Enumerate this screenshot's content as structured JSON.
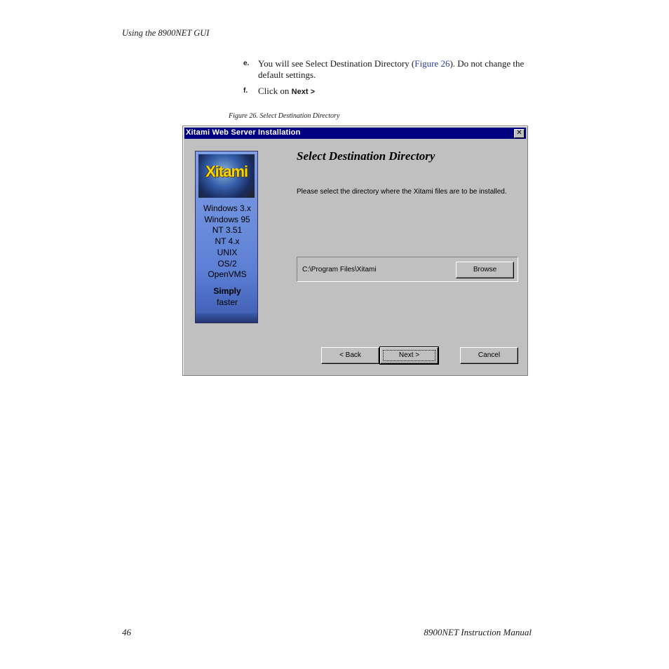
{
  "header": {
    "section": "Using the 8900NET GUI"
  },
  "steps": [
    {
      "label": "e.",
      "pre": "You will see Select Destination Directory (",
      "link": "Figure 26",
      "post": "). Do not change the default settings."
    },
    {
      "label": "f.",
      "pre": "Click on ",
      "action": "Next >"
    }
  ],
  "figure": {
    "caption": "Figure 26.  Select Destination Directory"
  },
  "dialog": {
    "title": "Xitami Web Server Installation",
    "close_glyph": "✕",
    "banner": {
      "logo": "Xitami",
      "platforms": [
        "Windows 3.x",
        "Windows 95",
        "NT 3.51",
        "NT 4.x",
        "UNIX",
        "OS/2",
        "OpenVMS"
      ],
      "tagline_1": "Simply",
      "tagline_2": "faster"
    },
    "heading": "Select Destination Directory",
    "instructions": "Please select the directory where the Xitami files are to be installed.",
    "destination_path": "C:\\Program Files\\Xitami",
    "buttons": {
      "browse": "Browse",
      "back": "< Back",
      "next": "Next >",
      "cancel": "Cancel"
    }
  },
  "footer": {
    "page_number": "46",
    "manual_title": "8900NET  Instruction Manual"
  }
}
